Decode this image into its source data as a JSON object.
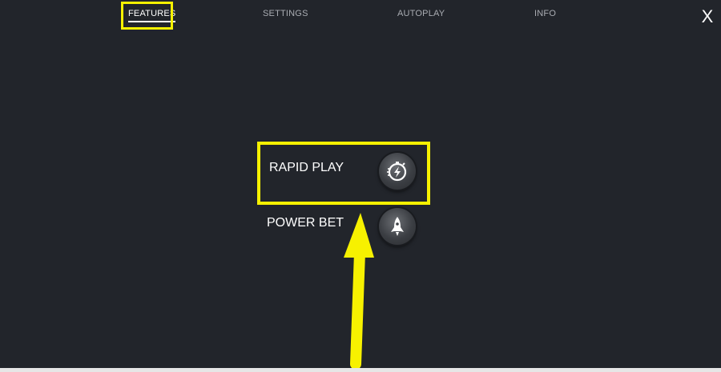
{
  "tabs": [
    {
      "label": "FEATURES",
      "active": true
    },
    {
      "label": "SETTINGS",
      "active": false
    },
    {
      "label": "AUTOPLAY",
      "active": false
    },
    {
      "label": "INFO",
      "active": false
    }
  ],
  "close_label": "X",
  "features": [
    {
      "label": "RAPID PLAY",
      "icon": "lightning-stopwatch-icon"
    },
    {
      "label": "POWER BET",
      "icon": "rocket-icon"
    }
  ],
  "colors": {
    "background": "#22252b",
    "highlight": "#f7f100",
    "text": "#ffffff",
    "tab_inactive": "#a9acb2"
  }
}
